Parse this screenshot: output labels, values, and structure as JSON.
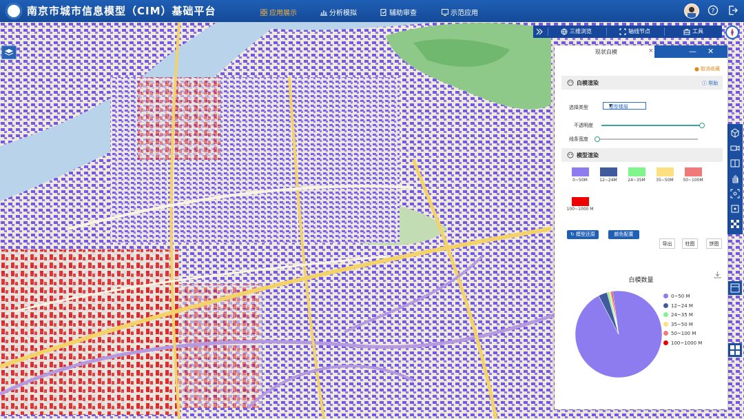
{
  "header": {
    "title": "南京市城市信息模型（CIM）基础平台",
    "nav": [
      {
        "label": "应用展示",
        "active": true,
        "icon": "grid-icon"
      },
      {
        "label": "分析模拟",
        "active": false,
        "icon": "chart-icon"
      },
      {
        "label": "辅助审查",
        "active": false,
        "icon": "doc-check-icon"
      },
      {
        "label": "示范应用",
        "active": false,
        "icon": "display-icon"
      }
    ],
    "colors": {
      "bar": "#1b55a8",
      "active": "#f6b43c"
    }
  },
  "toolbar": {
    "items": [
      {
        "label": "三维浏览",
        "icon": "globe-icon"
      },
      {
        "label": "轴线节点",
        "icon": "frame-icon"
      },
      {
        "label": "工具",
        "icon": "toolbox-icon"
      }
    ]
  },
  "panel": {
    "tab_title": "现状白模",
    "unfavorite": "取消收藏",
    "section_white": "白模渲染",
    "help": "帮助",
    "select_type_label": "选择类型",
    "select_value": "模型楼层",
    "opacity_label": "不透明度",
    "line_width_label": "线条宽度",
    "opacity_value": 1.0,
    "line_width_value": 0.0,
    "section_model": "模型渲染",
    "swatches": [
      {
        "label": "0~50M",
        "color": "#8c7cf0"
      },
      {
        "label": "12~24M",
        "color": "#3f5b9e"
      },
      {
        "label": "24~35M",
        "color": "#7ff58c"
      },
      {
        "label": "35~50M",
        "color": "#ffe080"
      },
      {
        "label": "50~100M",
        "color": "#f07a7a"
      },
      {
        "label": "100~1000 M",
        "color": "#ee0000"
      }
    ],
    "btn_restore": "模型还原",
    "btn_color": "颜色配置",
    "btn_export": "导出",
    "btn_bar": "柱图",
    "btn_pie": "饼图"
  },
  "chart_data": {
    "type": "pie",
    "title": "白模数量",
    "categories": [
      "0~50 M",
      "12~24 M",
      "24~35 M",
      "35~50 M",
      "50~100 M",
      "100~1000 M"
    ],
    "values": [
      94.6,
      3.3,
      0.8,
      0.4,
      0.5,
      0.4
    ],
    "colors": [
      "#8c7cf0",
      "#3f5b9e",
      "#7ff58c",
      "#ffe080",
      "#f07a7a",
      "#ee0000"
    ],
    "legend_position": "right"
  }
}
